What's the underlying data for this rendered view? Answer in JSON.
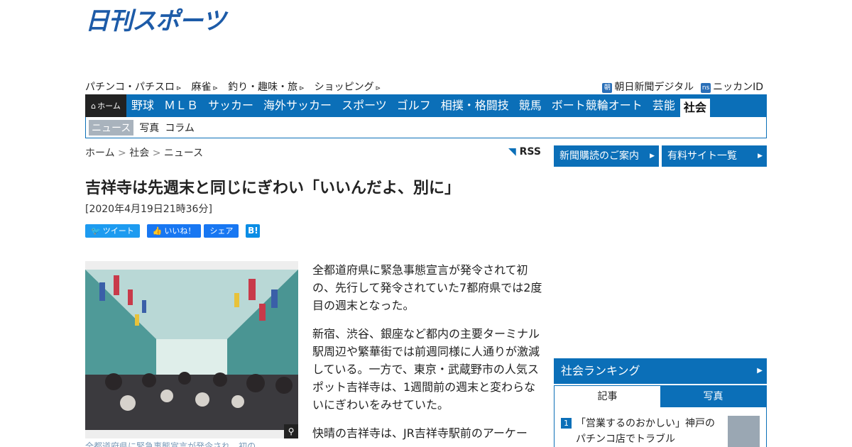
{
  "logo": {
    "text": "日刊スポーツ"
  },
  "toplinks": [
    "パチンコ・パチスロ",
    "麻雀",
    "釣り・趣味・旅",
    "ショッピング"
  ],
  "rightlinks": [
    {
      "icon": "朝",
      "label": "朝日新聞デジタル"
    },
    {
      "icon": "ns",
      "label": "ニッカンID"
    }
  ],
  "nav": {
    "home": "ホーム",
    "items": [
      "野球",
      "ＭＬＢ",
      "サッカー",
      "海外サッカー",
      "スポーツ",
      "ゴルフ",
      "相撲・格闘技",
      "競馬",
      "ボート競輪オート",
      "芸能",
      "社会"
    ],
    "active": "社会"
  },
  "subnav": [
    "ニュース",
    "写真",
    "コラム"
  ],
  "breadcrumb": {
    "a": "ホーム",
    "b": "社会",
    "c": "ニュース",
    "sep": ">"
  },
  "rss": "RSS",
  "article": {
    "title": "吉祥寺は先週末と同じにぎわい「いいんだよ、別に」",
    "date": "[2020年4月19日21時36分]",
    "paragraphs": [
      "全都道府県に緊急事態宣言が発令されて初の、先行して発令されていた7都府県では2度目の週末となった。",
      "新宿、渋谷、銀座など都内の主要ターミナル駅周辺や繁華街では前週同様に人通りが激減している。一方で、東京・武蔵野市の人気スポット吉祥寺は、1週間前の週末と変わらないにぎわいをみせていた。",
      "快晴の吉祥寺は、JR吉祥寺駅前のアーケー"
    ],
    "caption": "全都道府県に緊急事態宣言が発令され、初の"
  },
  "social": {
    "tweet": "ツイート",
    "like": "いいね！",
    "share": "シェア",
    "hatena": "B!"
  },
  "sidebar": {
    "btn1": "新聞購読のご案内",
    "btn2": "有料サイト一覧",
    "ranking_title": "社会ランキング",
    "tab1": "記事",
    "tab2": "写真",
    "rank1_num": "1",
    "rank1_text": "「営業するのおかしい」神戸のパチンコ店でトラブル"
  },
  "colors": {
    "brand": "#0b6fb8",
    "logo": "#1d5ba8"
  }
}
